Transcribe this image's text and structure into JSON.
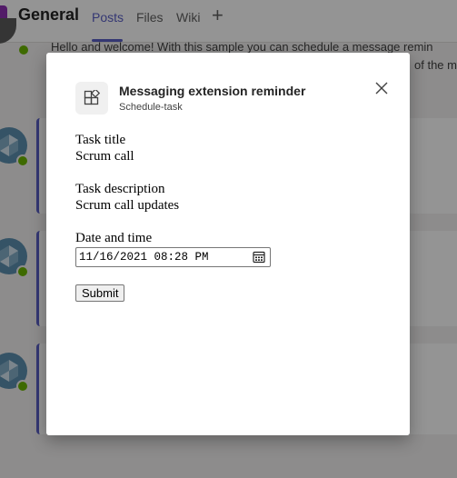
{
  "channel": {
    "name": "General",
    "tabs": [
      "Posts",
      "Files",
      "Wiki"
    ],
    "add_tab_label": "+"
  },
  "background_message": {
    "line1": "Hello and welcome! With this sample you can schedule a message remin",
    "line2": "of the m"
  },
  "dialog": {
    "title": "Messaging extension reminder",
    "subtitle": "Schedule-task",
    "fields": {
      "task_title_label": "Task title",
      "task_title_value": "Scrum call",
      "task_description_label": "Task description",
      "task_description_value": "Scrum call updates",
      "datetime_label": "Date and time",
      "datetime_value": "11/16/2021 08:28 PM"
    },
    "submit_label": "Submit"
  },
  "colors": {
    "accent": "#5b5fc7",
    "presence": "#6bb700",
    "channel_avatar": "#8e2fb4"
  },
  "icons": {
    "app": "app-grid-icon",
    "close": "close-icon",
    "calendar": "calendar-icon"
  }
}
